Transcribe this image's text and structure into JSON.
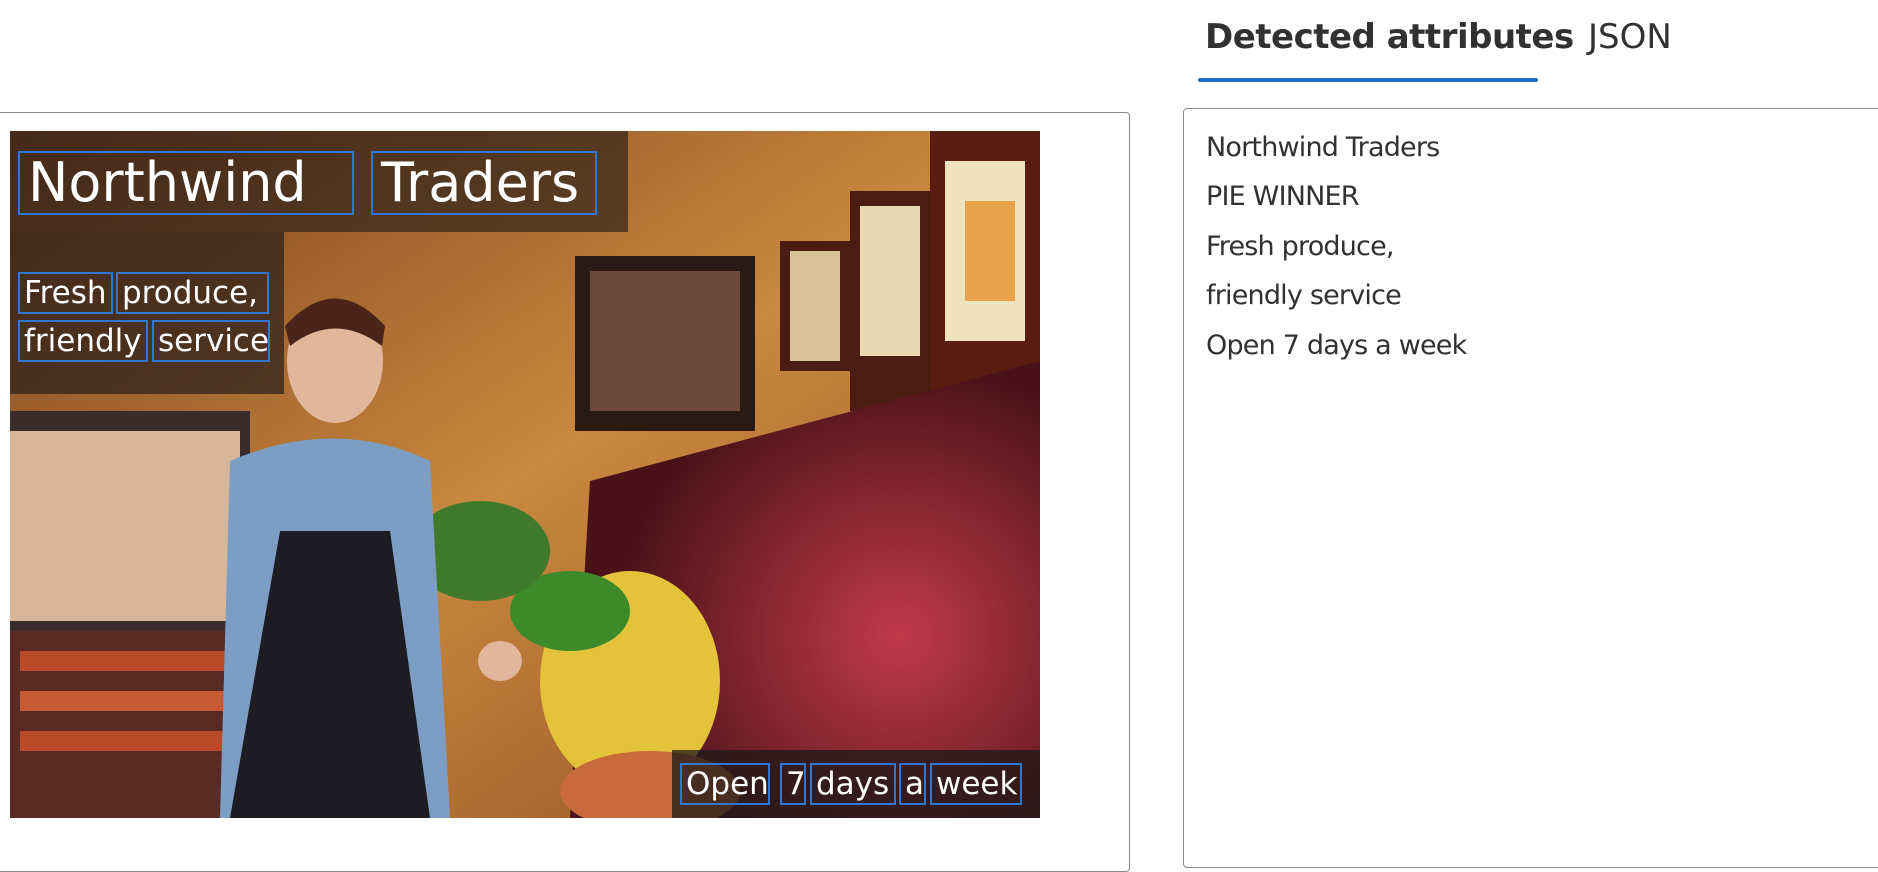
{
  "tabs": {
    "detected_label": "Detected attributes",
    "json_label": "JSON"
  },
  "image": {
    "title_words": [
      "Northwind",
      "Traders"
    ],
    "sub_line1_words": [
      "Fresh",
      "produce,"
    ],
    "sub_line2_words": [
      "friendly",
      "service"
    ],
    "bottom_words": [
      "Open",
      "7",
      "days",
      "a",
      "week"
    ]
  },
  "results": [
    "Northwind Traders",
    "PIE WINNER",
    "Fresh produce,",
    "friendly service",
    "Open 7 days a week"
  ],
  "colors": {
    "bounding_box": "#2f77d3",
    "active_tab_underline": "#1f6fd1",
    "border": "#8a8886"
  }
}
